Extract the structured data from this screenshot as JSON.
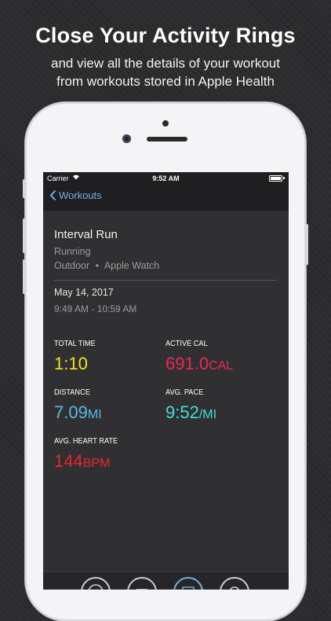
{
  "promo": {
    "headline": "Close Your Activity Rings",
    "sub_line1": "and view all the details of your workout",
    "sub_line2": "from workouts stored in Apple Health"
  },
  "status_bar": {
    "carrier": "Carrier",
    "time": "9:52 AM"
  },
  "nav": {
    "back_label": "Workouts"
  },
  "workout": {
    "title": "Interval Run",
    "type": "Running",
    "location": "Outdoor",
    "separator": "•",
    "device": "Apple Watch",
    "date": "May 14, 2017",
    "time_range": "9:49 AM - 10:59 AM"
  },
  "stats": {
    "total_time": {
      "label": "TOTAL TIME",
      "value": "1:10",
      "unit": "",
      "color": "#f5e21b"
    },
    "active_cal": {
      "label": "ACTIVE CAL",
      "value": "691.0",
      "unit": "CAL",
      "color": "#ee2853"
    },
    "distance": {
      "label": "DISTANCE",
      "value": "7.09",
      "unit": "MI",
      "color": "#5ab9ea"
    },
    "avg_pace": {
      "label": "AVG. PACE",
      "value": "9:52",
      "unit": "/MI",
      "color": "#3fe0d6"
    },
    "avg_heart_rate": {
      "label": "AVG. HEART RATE",
      "value": "144",
      "unit": "BPM",
      "color": "#e8262f"
    }
  },
  "tabs": [
    {
      "icon": "activity-rings-icon",
      "selected": false
    },
    {
      "icon": "list-icon",
      "selected": false
    },
    {
      "icon": "calendar-icon",
      "selected": true
    },
    {
      "icon": "gear-icon",
      "selected": false
    }
  ],
  "colors": {
    "accent_link": "#76aee6",
    "background": "#2b2b2e"
  }
}
